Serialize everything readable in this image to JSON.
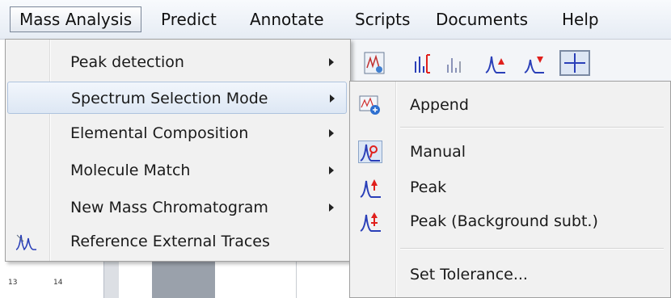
{
  "menubar": {
    "items": [
      {
        "label": "Mass Analysis",
        "active": true
      },
      {
        "label": "Predict"
      },
      {
        "label": "Annotate"
      },
      {
        "label": "Scripts"
      },
      {
        "label": "Documents"
      },
      {
        "label": "Help"
      }
    ]
  },
  "mass_analysis_menu": {
    "items": [
      {
        "label": "Peak detection",
        "has_submenu": true
      },
      {
        "label": "Spectrum Selection Mode",
        "has_submenu": true,
        "highlighted": true
      },
      {
        "label": "Elemental Composition",
        "has_submenu": true
      },
      {
        "label": "Molecule Match",
        "has_submenu": true
      },
      {
        "label": "New Mass Chromatogram",
        "has_submenu": true
      },
      {
        "label": "Reference External Traces",
        "icon": "reference-traces-icon"
      }
    ]
  },
  "spectrum_selection_submenu": {
    "items": [
      {
        "label": "Append",
        "icon": "append-icon"
      },
      {
        "label": "Manual",
        "icon": "manual-peak-icon",
        "selected": true
      },
      {
        "label": "Peak",
        "icon": "peak-icon"
      },
      {
        "label": "Peak (Background subt.)",
        "icon": "peak-background-icon"
      },
      {
        "label": "Set Tolerance..."
      }
    ]
  },
  "background": {
    "axis_ticks": [
      "13",
      "14"
    ]
  },
  "colors": {
    "highlight": "#dde7f4",
    "menu_bg": "#f1f1f1",
    "icon_blue": "#2a3fb8",
    "icon_red": "#e0201c"
  }
}
